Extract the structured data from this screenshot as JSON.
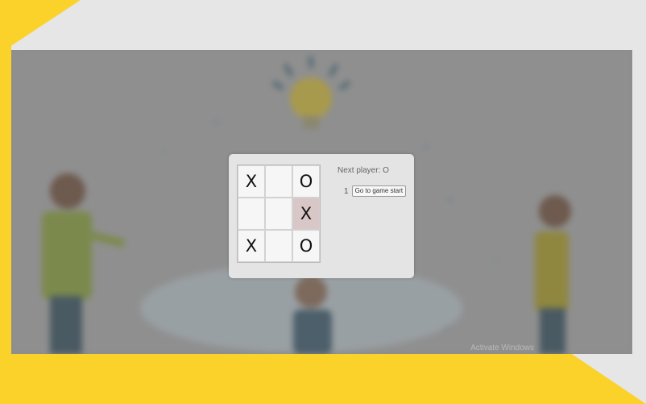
{
  "game": {
    "status": "Next player: O",
    "board": [
      "X",
      "",
      "O",
      "",
      "",
      "X",
      "X",
      "",
      "O"
    ],
    "highlight_index": 5,
    "moves": [
      {
        "number": "1",
        "label": "Go to game start"
      }
    ]
  },
  "watermark": "Activate Windows",
  "colors": {
    "frame_yellow": "#fbd22a",
    "page_background": "#e6e6e6",
    "highlight_cell": "#d9c7c7"
  }
}
